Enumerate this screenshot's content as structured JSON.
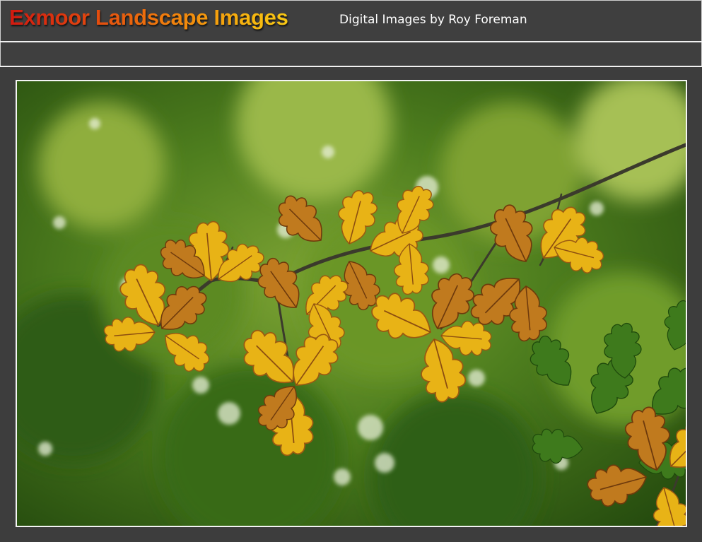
{
  "header": {
    "title": "Exmoor Landscape Images",
    "subtitle": "Digital Images by Roy Foreman"
  },
  "photo": {
    "subject": "oak-leaves-icon",
    "colors": {
      "background_dark": "#2f5a14",
      "background_mid": "#5c8a22",
      "leaf_gold": "#e8b316",
      "leaf_rust": "#b5631c",
      "leaf_green": "#3e7a1c",
      "branch": "#3b3a2c"
    }
  },
  "colors": {
    "page_bg": "#3d3d3d",
    "rule": "#f2f2f2",
    "title_start": "#d11a10",
    "title_end": "#f8c814",
    "subtitle": "#ffffff"
  }
}
